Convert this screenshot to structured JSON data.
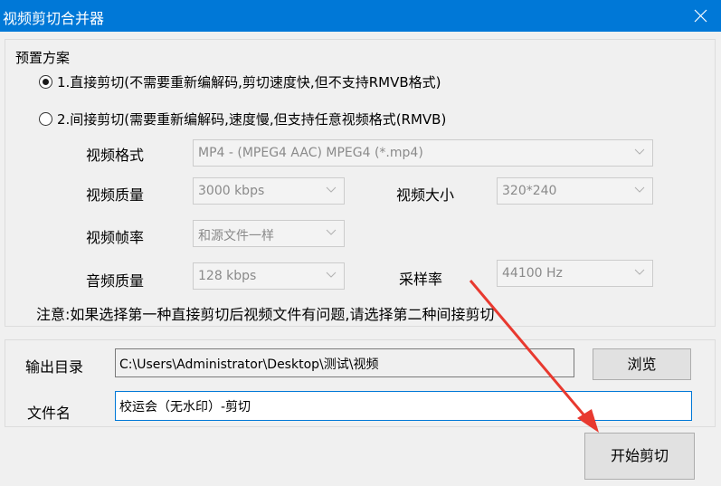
{
  "window": {
    "title": "视频剪切合并器",
    "close_icon": "close-icon"
  },
  "preset": {
    "group_title": "预置方案",
    "option1": {
      "label": "1.直接剪切(不需要重新编解码,剪切速度快,但不支持RMVB格式)",
      "checked": true
    },
    "option2": {
      "label": "2.间接剪切(需要重新编解码,速度慢,但支持任意视频格式(RMVB)",
      "checked": false
    }
  },
  "settings": {
    "video_format": {
      "label": "视频格式",
      "value": "MP4 - (MPEG4 AAC) MPEG4 (*.mp4)"
    },
    "video_quality": {
      "label": "视频质量",
      "value": "3000 kbps"
    },
    "video_size": {
      "label": "视频大小",
      "value": "320*240"
    },
    "frame_rate": {
      "label": "视频帧率",
      "value": "和源文件一样"
    },
    "audio_quality": {
      "label": "音频质量",
      "value": "128 kbps"
    },
    "sample_rate": {
      "label": "采样率",
      "value": "44100 Hz"
    }
  },
  "note": "注意:如果选择第一种直接剪切后视频文件有问题,请选择第二种间接剪切",
  "output": {
    "dir_label": "输出目录",
    "dir_value": "C:\\Users\\Administrator\\Desktop\\测试\\视频",
    "browse_label": "浏览",
    "filename_label": "文件名",
    "filename_value": "校运会（无水印）-剪切"
  },
  "actions": {
    "start_label": "开始剪切"
  },
  "annotation": {
    "arrow_color": "#e8392f"
  },
  "colors": {
    "titlebar": "#0078d7",
    "dialog_bg": "#f0f0f0"
  }
}
